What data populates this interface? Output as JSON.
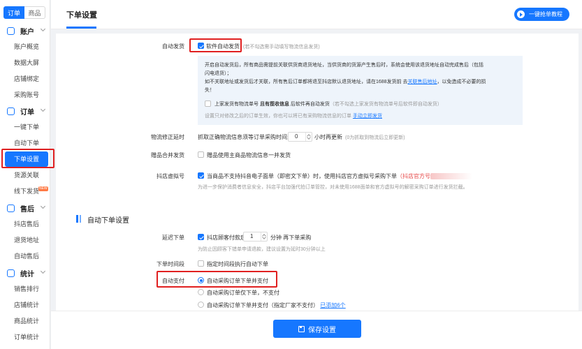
{
  "sidebar": {
    "tabs": [
      {
        "label": "订单",
        "active": true
      },
      {
        "label": "商品",
        "active": false
      }
    ],
    "groups": [
      {
        "label": "账户",
        "icon": "account-icon",
        "items": [
          "账户概览",
          "数据大屏",
          "店铺绑定",
          "采购账号"
        ]
      },
      {
        "label": "订单",
        "icon": "order-icon",
        "items": [
          "一键下单",
          "自动下单",
          "下单设置",
          "货源关联",
          "线下发货"
        ]
      },
      {
        "label": "售后",
        "icon": "aftersale-icon",
        "items": [
          "抖店售后",
          "退货地址",
          "自动售后"
        ]
      },
      {
        "label": "统计",
        "icon": "stats-icon",
        "items": [
          "销售排行",
          "店铺统计",
          "商品统计",
          "订单统计"
        ]
      }
    ],
    "active_item": "下单设置",
    "new_badge": "NEW"
  },
  "header": {
    "title": "下单设置",
    "tutorial_button": "一键抢单教程"
  },
  "auto_ship": {
    "label": "自动发货",
    "checkbox_label": "软件自动发货",
    "checked": true,
    "hint": "(若不勾选需手动填写物流信息发货)",
    "info_line1": "开启自动发货后，所有商品需提前关联供货商退货地址，当供货商的货源产生售后时，系统会使用该退货地址自动完成售后（包括",
    "info_line2": "闪电退货）；",
    "info_line3_a": "如不关联地址或发货后才关联，所有售后订单都将退至抖店默认退货地址，请在1688发货前 去",
    "info_line3_link": "关联售后地址",
    "info_line3_b": "，以免造成不必要的损",
    "info_line4": "失！",
    "sub_checkbox_label_a": "上家发货有物流单号",
    "sub_checkbox_label_bold": "且有揽收信息",
    "sub_checkbox_label_b": "后软件再自动发货",
    "sub_checkbox_hint": "（若不勾选上家发货有物流单号后软件即自动发货）",
    "sub_checked": false,
    "sub_note": "设置只对修改之后的订单生效，你也可以将已有采购物流信息的订单",
    "sub_note_link": "手动立即发货"
  },
  "logistics_delay": {
    "label": "物流修正延时",
    "text_a": "抓取正确物流信息须等订单采购时间满",
    "value": "0",
    "text_b": "小时再更新",
    "hint": "(0为抓取到物流后立即更新)"
  },
  "gift_merge": {
    "label": "赠品合并发货",
    "checkbox_label": "赠品使用主商品物流信息一并发货",
    "checked": false
  },
  "virtual_number": {
    "label": "抖店虚拟号",
    "checkbox_label": "当商品不支持抖音电子面单（即密文下单）时，使用抖店官方虚拟号采购下单",
    "red_note": "（抖店官方号",
    "checked": true,
    "note": "为进一步保护消费者信息安全，抖店平台加强代拍订单管控，对未使用1688面单和官方虚拟号的解密采购订单进行发货拦截。"
  },
  "auto_order_section": {
    "title": "自动下单设置"
  },
  "delay_order": {
    "label": "延迟下单",
    "checkbox_label": "抖店顾客付款后",
    "value": "1",
    "text_b": "分钟 再下单采购",
    "checked": true,
    "hint": "为防止因顾客下错单申请退款，建议设置为延时30分钟以上"
  },
  "order_time": {
    "label": "下单时间段",
    "checkbox_label": "指定时间段执行自动下单",
    "checked": false
  },
  "auto_pay": {
    "label": "自动支付",
    "options": [
      {
        "label": "自动采购订单下单并支付",
        "selected": true
      },
      {
        "label": "自动采购订单仅下单，不支付",
        "selected": false
      },
      {
        "label": "自动采购订单下单并支付（指定厂家不支付）",
        "selected": false
      }
    ],
    "added_link": "已添加6个"
  },
  "footer": {
    "save_button": "保存设置"
  },
  "colors": {
    "primary": "#1677ff",
    "highlight_box": "#e02020"
  }
}
